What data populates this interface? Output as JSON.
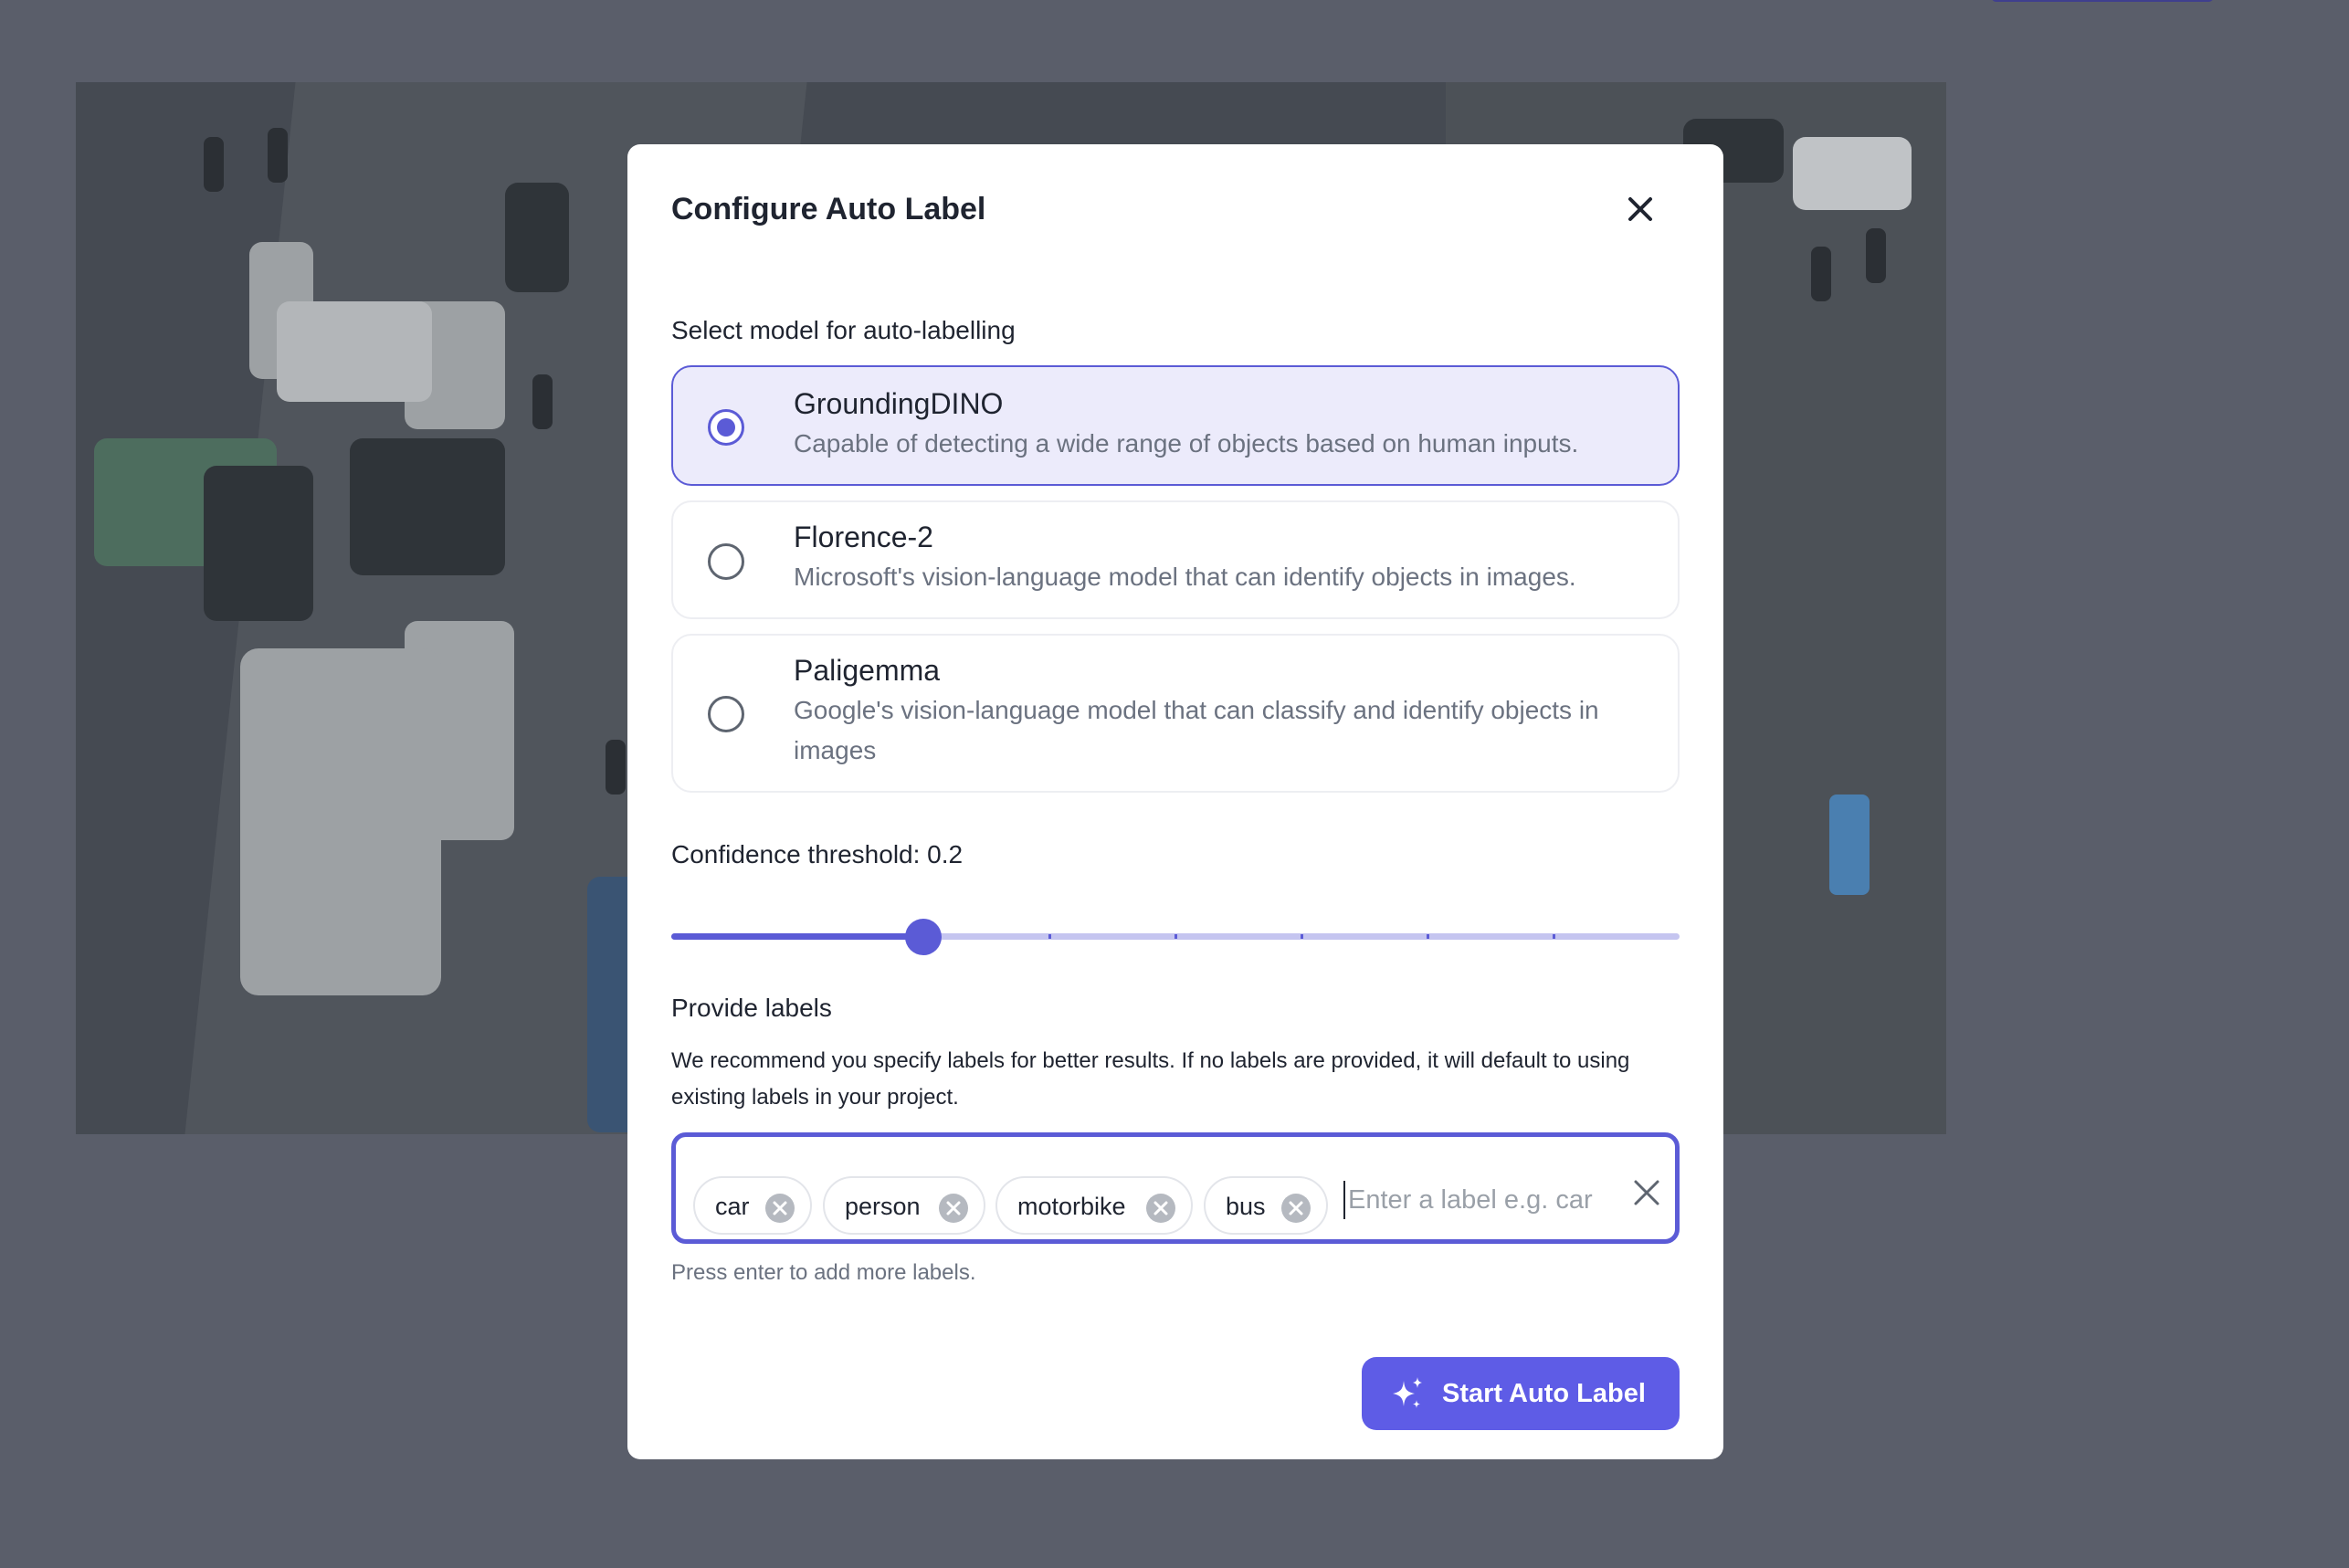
{
  "modal": {
    "title": "Configure Auto Label",
    "close_icon": "close-icon"
  },
  "model_section": {
    "label": "Select model for auto-labelling",
    "options": [
      {
        "name": "GroundingDINO",
        "description": "Capable of detecting a wide range of objects based on human inputs.",
        "selected": true
      },
      {
        "name": "Florence-2",
        "description": "Microsoft's vision-language model that can identify objects in images.",
        "selected": false
      },
      {
        "name": "Paligemma",
        "description": "Google's vision-language model that can classify and identify objects in images",
        "selected": false
      }
    ]
  },
  "confidence": {
    "label": "Confidence threshold: 0.2",
    "value": 0.2,
    "min": 0,
    "max": 0.8,
    "step": 0.1
  },
  "labels_section": {
    "title": "Provide labels",
    "description": "We recommend you specify labels for better results. If no labels are provided, it will default to using existing labels in your project.",
    "chips": [
      "car",
      "person",
      "motorbike",
      "bus"
    ],
    "input_placeholder": "Enter a label e.g. car",
    "input_value": "",
    "helper": "Press enter to add more labels.",
    "clear_icon": "close-icon",
    "chip_remove_icon": "circle-x-icon"
  },
  "start_button": {
    "label": "Start Auto Label",
    "icon": "sparkles-icon"
  },
  "colors": {
    "accent": "#5b5bd6",
    "selected_bg": "#ecebfb",
    "overlay": "#585c68"
  }
}
